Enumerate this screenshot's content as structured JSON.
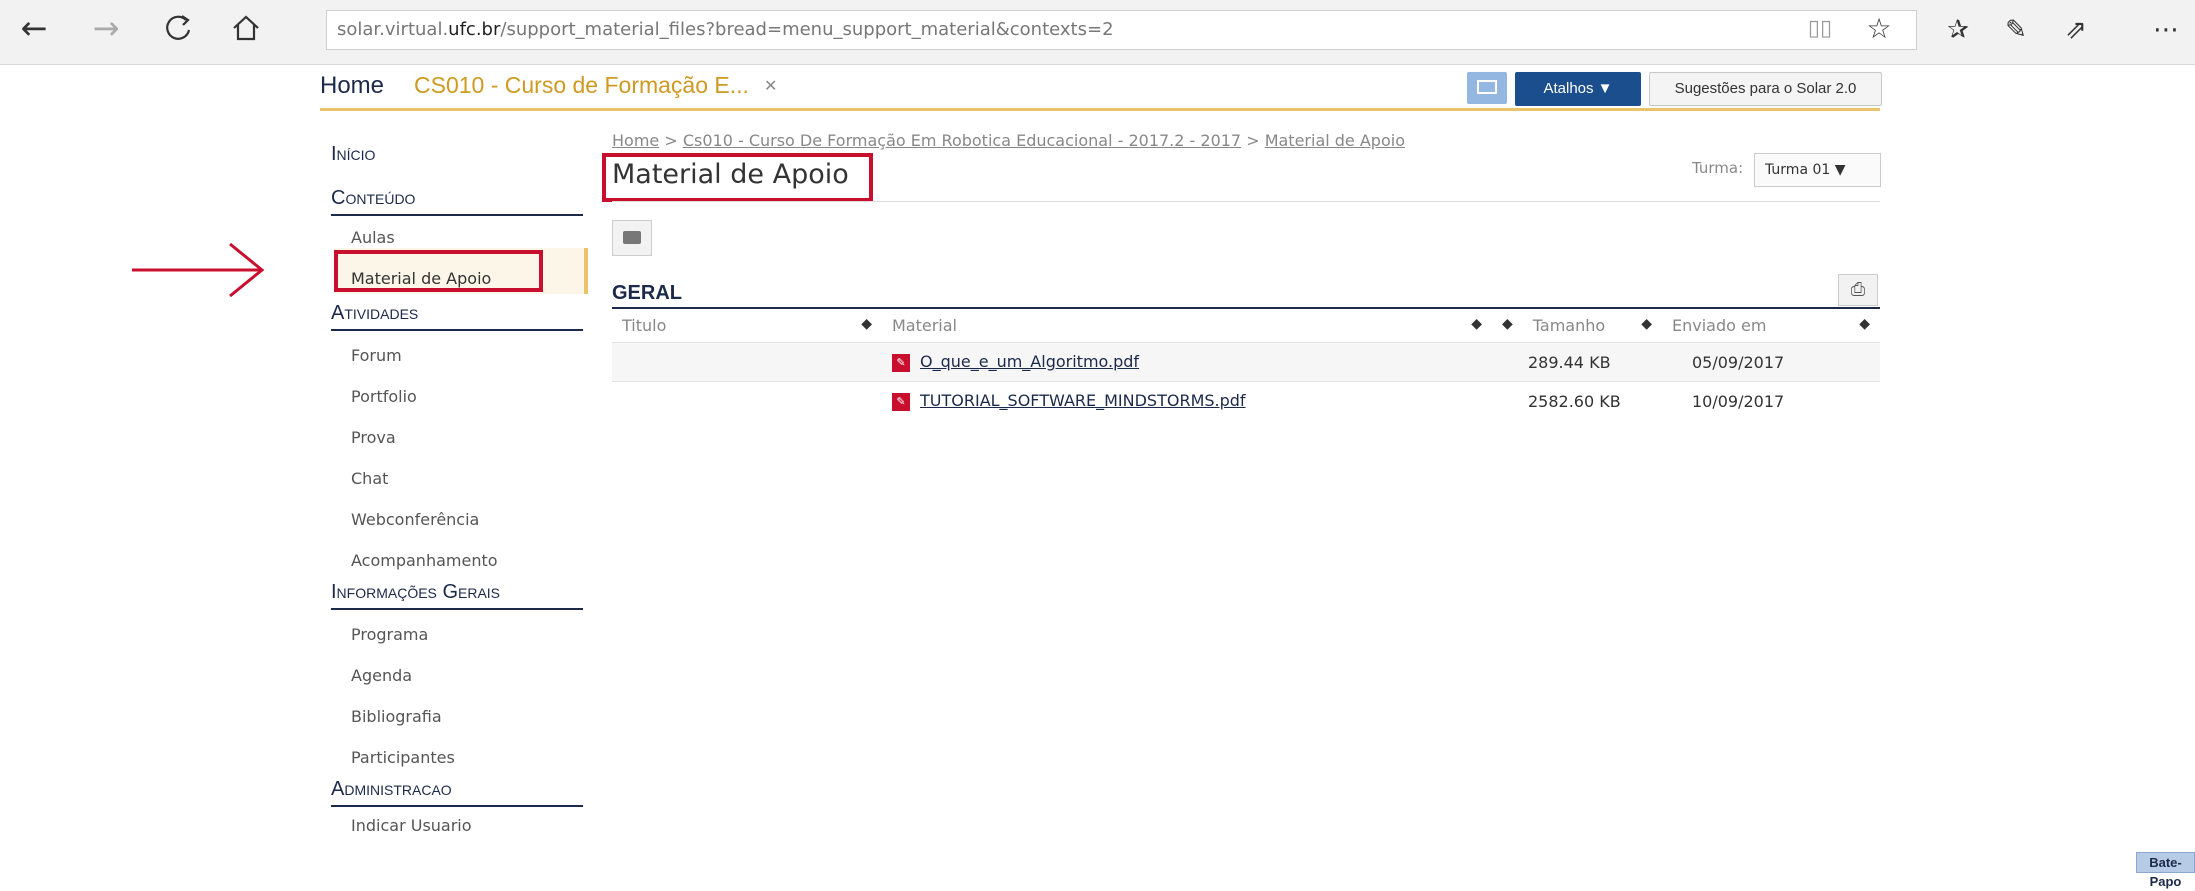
{
  "browser": {
    "url_prefix": "solar.virtual.",
    "url_domain": "ufc.br",
    "url_path": "/support_material_files?bread=menu_support_material&contexts=2",
    "icons": [
      "back-icon",
      "forward-icon",
      "refresh-icon",
      "home-icon",
      "reading-view-icon",
      "favorite-star-icon",
      "favorites-list-icon",
      "pen-icon",
      "share-icon",
      "more-icon"
    ]
  },
  "header": {
    "home_tab": "Home",
    "course_tab": "CS010 - Curso de Formação E...",
    "course_close": "✕",
    "atalhos_label": "Atalhos ▼",
    "sugestoes_label": "Sugestões para o Solar 2.0"
  },
  "sidebar": {
    "inicio": "Início",
    "sections": [
      {
        "title": "Conteúdo",
        "items": [
          "Aulas",
          "Material de Apoio"
        ]
      },
      {
        "title": "Atividades",
        "items": [
          "Forum",
          "Portfolio",
          "Prova",
          "Chat",
          "Webconferência",
          "Acompanhamento"
        ]
      },
      {
        "title": "Informações Gerais",
        "items": [
          "Programa",
          "Agenda",
          "Bibliografia",
          "Participantes"
        ]
      },
      {
        "title": "Administracao",
        "items": [
          "Indicar Usuario"
        ]
      }
    ]
  },
  "breadcrumb": {
    "home": "Home",
    "sep": " > ",
    "course": "Cs010 - Curso De Formação Em Robotica Educacional - 2017.2 - 2017",
    "current": "Material de Apoio"
  },
  "main": {
    "title": "Material de Apoio",
    "turma_label": "Turma:",
    "turma_value": "Turma 01 ▼",
    "section": "GERAL",
    "columns": [
      "Titulo",
      "Material",
      "Tamanho",
      "Enviado em"
    ],
    "rows": [
      {
        "titulo": "",
        "material": "O_que_e_um_Algoritmo.pdf",
        "tamanho": "289.44 KB",
        "enviado": "05/09/2017"
      },
      {
        "titulo": "",
        "material": "TUTORIAL_SOFTWARE_MINDSTORMS.pdf",
        "tamanho": "2582.60 KB",
        "enviado": "10/09/2017"
      }
    ]
  },
  "chat": {
    "label": "Bate-Papo"
  },
  "colors": {
    "highlight": "#c8102e",
    "brand_navy": "#1b2a4a",
    "accent_gold": "#e9c46a"
  }
}
